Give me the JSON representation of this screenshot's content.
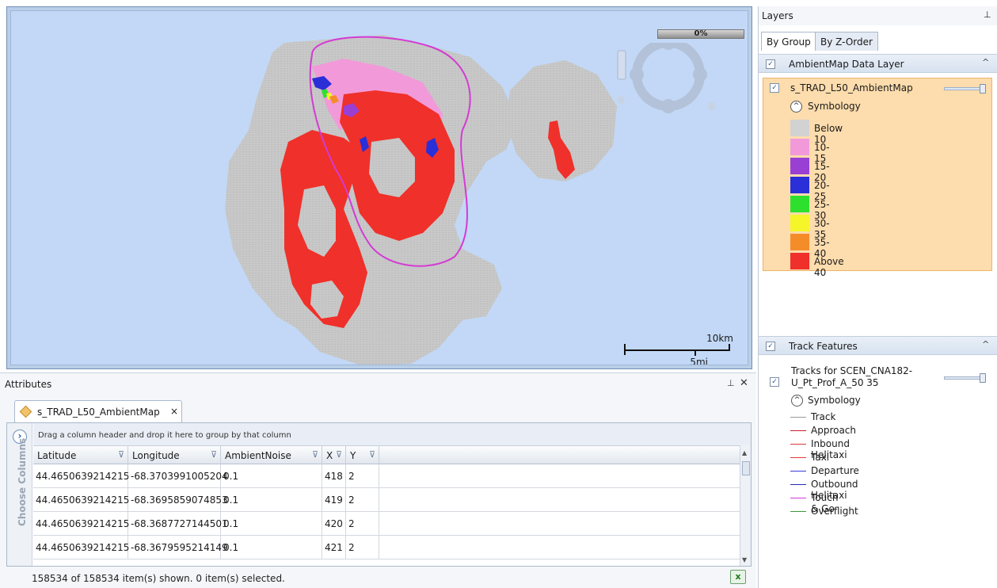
{
  "map": {
    "progress": {
      "text": "0%",
      "value": 0
    },
    "scale": {
      "km_label": "10km",
      "mi_label": "5mi"
    }
  },
  "attributes": {
    "title": "Attributes",
    "pin_icon": "pin-icon",
    "close_icon": "close-icon",
    "tab_label": "s_TRAD_L50_AmbientMap",
    "tab_close": "×",
    "choose_columns": "Choose Columns",
    "drag_hint": "Drag a column header and drop it here to group by that column",
    "columns": [
      "Latitude",
      "Longitude",
      "AmbientNoise",
      "X",
      "Y"
    ],
    "rows": [
      [
        "44.4650639214215",
        "-68.3703991005204",
        "0.1",
        "418",
        "2"
      ],
      [
        "44.4650639214215",
        "-68.3695859074853",
        "0.1",
        "419",
        "2"
      ],
      [
        "44.4650639214215",
        "-68.3687727144501",
        "0.1",
        "420",
        "2"
      ],
      [
        "44.4650639214215",
        "-68.3679595214149",
        "0.1",
        "421",
        "2"
      ]
    ],
    "status": "158534 of 158534 item(s) shown. 0 item(s) selected."
  },
  "layers": {
    "title": "Layers",
    "tabs": [
      "By Group",
      "By Z-Order"
    ],
    "ambient_group": {
      "label": "AmbientMap Data Layer",
      "layer_name": "s_TRAD_L50_AmbientMap",
      "symbology": "Symbology",
      "legend": [
        {
          "label": "Below 10",
          "color": "#d2d2d2"
        },
        {
          "label": "10-15",
          "color": "#f29ad9"
        },
        {
          "label": "15-20",
          "color": "#9a3fd4"
        },
        {
          "label": "20-25",
          "color": "#2a2fd8"
        },
        {
          "label": "25-30",
          "color": "#2ee02e"
        },
        {
          "label": "30-35",
          "color": "#f5f52a"
        },
        {
          "label": "35-40",
          "color": "#f58c2a"
        },
        {
          "label": "Above 40",
          "color": "#f0302a"
        }
      ]
    },
    "track_group": {
      "label": "Track Features",
      "layer_name_line1": "Tracks for SCEN_CNA182-",
      "layer_name_line2": "U_Pt_Prof_A_50 35",
      "symbology": "Symbology",
      "tracks": [
        {
          "label": "Track",
          "color": "#9a9a9a"
        },
        {
          "label": "Approach",
          "color": "#c81e2a"
        },
        {
          "label": "Inbound Helitaxi",
          "color": "#d83a3a"
        },
        {
          "label": "Taxi",
          "color": "#e23a3a"
        },
        {
          "label": "Departure",
          "color": "#3a3ad8"
        },
        {
          "label": "Outbound Helitaxi",
          "color": "#2a2ab0"
        },
        {
          "label": "Touch & Go",
          "color": "#d43ad4"
        },
        {
          "label": "Overflight",
          "color": "#3a9a3a"
        }
      ]
    }
  }
}
